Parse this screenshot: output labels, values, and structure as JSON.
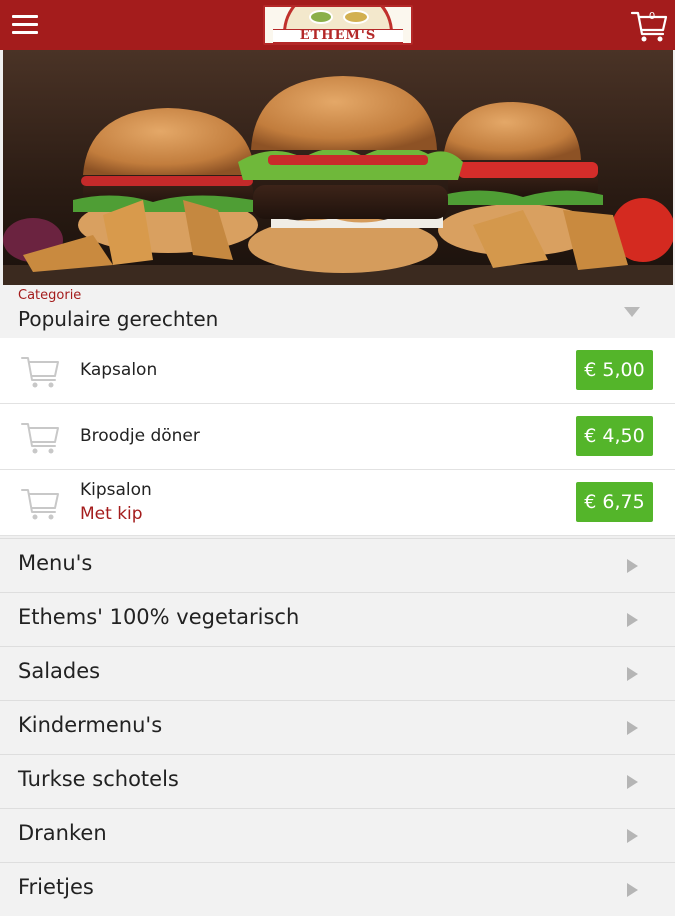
{
  "header": {
    "logo_text": "ETHEM'S",
    "cart_count": "0",
    "menu_icon": "hamburger-menu-icon",
    "cart_icon": "shopping-cart-icon"
  },
  "hero": {
    "image": "burgers-with-potato-wedges-photo"
  },
  "category_selector": {
    "label": "Categorie",
    "value": "Populaire gerechten"
  },
  "dishes": [
    {
      "name": "Kapsalon",
      "subtitle": "",
      "price": "€ 5,00"
    },
    {
      "name": "Broodje döner",
      "subtitle": "",
      "price": "€ 4,50"
    },
    {
      "name": "Kipsalon",
      "subtitle": "Met kip",
      "price": "€ 6,75"
    }
  ],
  "categories": [
    "Menu's",
    "Ethems' 100% vegetarisch",
    "Salades",
    "Kindermenu's",
    "Turkse schotels",
    "Dranken",
    "Frietjes"
  ],
  "colors": {
    "brand_red": "#a41c1c",
    "price_green": "#54b52a",
    "background": "#f2f2f2"
  }
}
